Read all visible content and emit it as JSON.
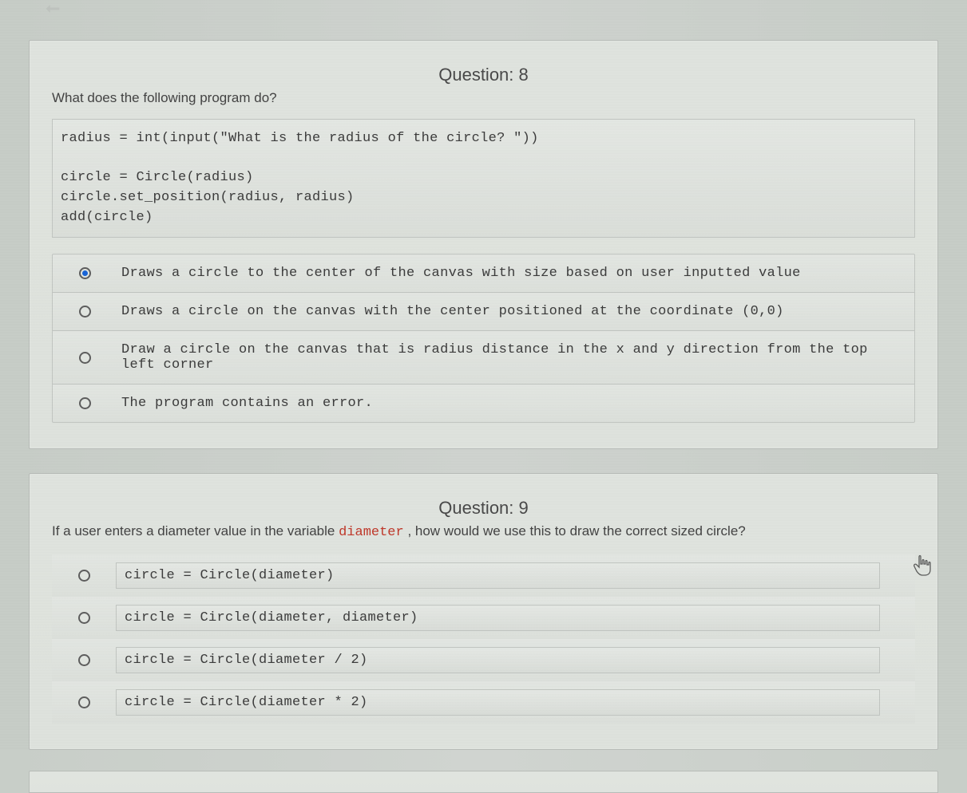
{
  "questions": [
    {
      "number_label": "Question: 8",
      "prompt": "What does the following program do?",
      "code": "radius = int(input(\"What is the radius of the circle? \"))\n\ncircle = Circle(radius)\ncircle.set_position(radius, radius)\nadd(circle)",
      "options": [
        {
          "text": "Draws a circle to the center of the canvas with size based on user inputted value",
          "selected": true
        },
        {
          "text": "Draws a circle on the canvas with the center positioned at the coordinate (0,0)",
          "selected": false
        },
        {
          "text": "Draw a circle on the canvas that is radius distance in the x and y direction from the top left corner",
          "selected": false
        },
        {
          "text": "The program contains an error.",
          "selected": false
        }
      ]
    },
    {
      "number_label": "Question: 9",
      "prompt_before": "If a user enters a diameter value in the variable ",
      "prompt_code": "diameter",
      "prompt_after": " , how would we use this to draw the correct sized circle?",
      "options": [
        {
          "text": "circle  = Circle(diameter)",
          "selected": false
        },
        {
          "text": "circle  = Circle(diameter, diameter)",
          "selected": false
        },
        {
          "text": "circle  = Circle(diameter / 2)",
          "selected": false
        },
        {
          "text": "circle  = Circle(diameter * 2)",
          "selected": false
        }
      ]
    }
  ]
}
